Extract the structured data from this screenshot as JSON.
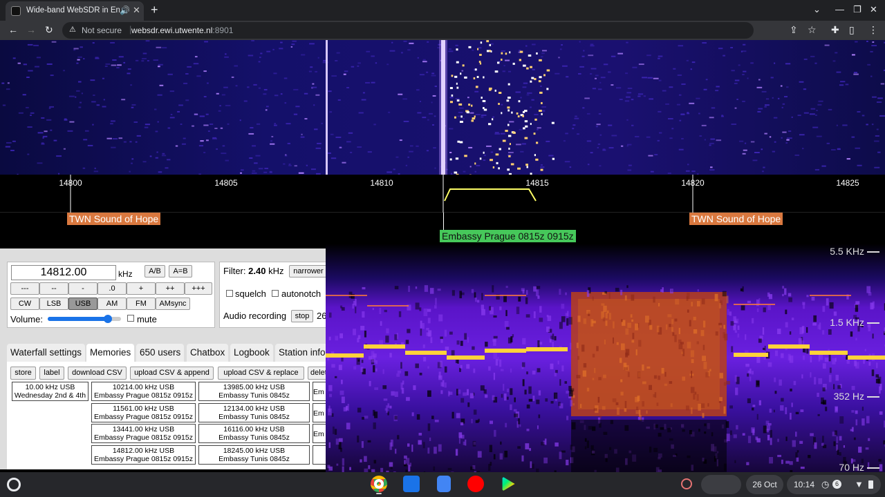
{
  "browser": {
    "tab_title": "Wide-band WebSDR in Ensch",
    "new_tab": "+",
    "not_secure": "Not secure",
    "url_host": "websdr.ewi.utwente.nl",
    "url_port": ":8901"
  },
  "scale": {
    "ticks": [
      "14800",
      "14805",
      "14810",
      "14815",
      "14820",
      "14825"
    ]
  },
  "stations": [
    {
      "label": "TWN Sound of Hope",
      "color": "orange"
    },
    {
      "label": "Embassy Prague 0815z 0915z",
      "color": "green"
    },
    {
      "label": "TWN Sound of Hope",
      "color": "orange"
    }
  ],
  "tuner": {
    "frequency": "14812.00",
    "unit": "kHz",
    "ab": "A/B",
    "aeqb": "A=B",
    "steps": [
      "---",
      "--",
      "-",
      ".0",
      "+",
      "++",
      "+++"
    ],
    "modes": [
      "CW",
      "LSB",
      "USB",
      "AM",
      "FM",
      "AMsync"
    ],
    "selected_mode": "USB",
    "volume_label": "Volume:",
    "volume_level": 0.82,
    "mute": "mute"
  },
  "filter": {
    "label": "Filter:",
    "value": "2.40",
    "unit": "kHz",
    "narrower": "narrower",
    "squelch": "squelch",
    "autonotch": "autonotch",
    "recording": "Audio recording",
    "stop": "stop",
    "rec_value": "26"
  },
  "tabs": [
    "Waterfall settings",
    "Memories",
    "650 users",
    "Chatbox",
    "Logbook",
    "Station info"
  ],
  "active_tab": "Memories",
  "memory_buttons": [
    "store",
    "label",
    "download CSV",
    "upload CSV & append",
    "upload CSV & replace",
    "delet"
  ],
  "memories": {
    "col0": [
      {
        "l1": "10.00 kHz USB",
        "l2": "Wednesday 2nd & 4th"
      }
    ],
    "col1": [
      {
        "l1": "10214.00 kHz USB",
        "l2": "Embassy Prague 0815z 0915z"
      },
      {
        "l1": "11561.00 kHz USB",
        "l2": "Embassy Prague 0815z 0915z"
      },
      {
        "l1": "13441.00 kHz USB",
        "l2": "Embassy Prague 0815z 0915z"
      },
      {
        "l1": "14812.00 kHz USB",
        "l2": "Embassy Prague 0815z 0915z"
      }
    ],
    "col2": [
      {
        "l1": "13985.00 kHz USB",
        "l2": "Embassy Tunis 0845z"
      },
      {
        "l1": "12134.00 kHz USB",
        "l2": "Embassy Tunis 0845z"
      },
      {
        "l1": "16116.00 kHz USB",
        "l2": "Embassy Tunis 0845z"
      },
      {
        "l1": "18245.00 kHz USB",
        "l2": "Embassy Tunis 0845z"
      }
    ],
    "col3": [
      "Em",
      "Em",
      "Em",
      ""
    ]
  },
  "spectrogram": {
    "labels": [
      "5.5 KHz",
      "1.5 KHz",
      "352 Hz",
      "70 Hz"
    ]
  },
  "shelf": {
    "date": "26 Oct",
    "time": "10:14",
    "badge": "6"
  },
  "colors": {
    "accent_orange": "#d9783f",
    "accent_green": "#46c85a"
  }
}
